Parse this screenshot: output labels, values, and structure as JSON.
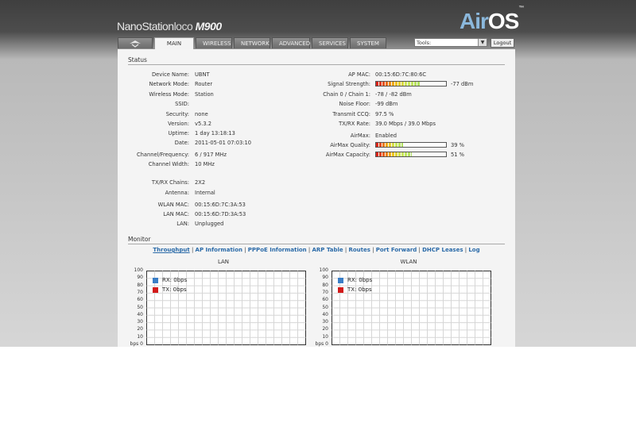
{
  "header": {
    "brand_name": "NanoStation",
    "brand_loco": "loco",
    "brand_model": "M900",
    "logo_air": "Air",
    "logo_os": "OS",
    "logo_tm": "™"
  },
  "tabs": [
    {
      "label": "",
      "icon": "ubiquiti-logo-icon"
    },
    {
      "label": "MAIN"
    },
    {
      "label": "WIRELESS"
    },
    {
      "label": "NETWORK"
    },
    {
      "label": "ADVANCED"
    },
    {
      "label": "SERVICES"
    },
    {
      "label": "SYSTEM"
    }
  ],
  "tools": {
    "selected": "Tools:",
    "arrow": "▼"
  },
  "logout_label": "Logout",
  "status": {
    "title": "Status",
    "left": [
      {
        "label": "Device Name:",
        "value": "UBNT"
      },
      {
        "label": "Network Mode:",
        "value": "Router"
      },
      {
        "label": "Wireless Mode:",
        "value": "Station"
      },
      {
        "label": "SSID:",
        "value": ""
      },
      {
        "label": "Security:",
        "value": "none"
      },
      {
        "label": "Version:",
        "value": "v5.3.2"
      },
      {
        "label": "Uptime:",
        "value": "1 day 13:18:13"
      },
      {
        "label": "Date:",
        "value": "2011-05-01 07:03:10"
      },
      {
        "label": "Channel/Frequency:",
        "value": "6 / 917 MHz"
      },
      {
        "label": "Channel Width:",
        "value": "10 MHz"
      },
      {
        "label": "TX/RX Chains:",
        "value": "2X2"
      },
      {
        "label": "Antenna:",
        "value": "Internal"
      },
      {
        "label": "WLAN MAC:",
        "value": "00:15:6D:7C:3A:53"
      },
      {
        "label": "LAN MAC:",
        "value": "00:15:6D:7D:3A:53"
      },
      {
        "label": "LAN:",
        "value": "Unplugged"
      }
    ],
    "right": [
      {
        "label": "AP MAC:",
        "value": "00:15:6D:7C:80:6C"
      },
      {
        "label": "Signal Strength:",
        "value": "-77 dBm",
        "meter": 0.62
      },
      {
        "label": "Chain 0 / Chain 1:",
        "value": "-78 / -82 dBm"
      },
      {
        "label": "Noise Floor:",
        "value": "-99 dBm"
      },
      {
        "label": "Transmit CCQ:",
        "value": "97.5 %"
      },
      {
        "label": "TX/RX Rate:",
        "value": "39.0 Mbps / 39.0 Mbps"
      },
      {
        "label": "AirMax:",
        "value": "Enabled"
      },
      {
        "label": "AirMax Quality:",
        "value": "39 %",
        "meter": 0.39
      },
      {
        "label": "AirMax Capacity:",
        "value": "51 %",
        "meter": 0.51
      }
    ]
  },
  "monitor": {
    "title": "Monitor",
    "links": [
      "Throughput",
      "AP Information",
      "PPPoE Information",
      "ARP Table",
      "Routes",
      "Port Forward",
      "DHCP Leases",
      "Log"
    ],
    "separator": "|"
  },
  "chart_data": [
    {
      "type": "line",
      "title": "LAN",
      "y_ticks": [
        "100",
        "90",
        "80",
        "70",
        "60",
        "50",
        "40",
        "30",
        "20",
        "10",
        "bps 0"
      ],
      "ylim": [
        0,
        100
      ],
      "series": [
        {
          "name": "RX: 0bps",
          "color": "#3a7ec6",
          "values": []
        },
        {
          "name": "TX: 0bps",
          "color": "#d21a1a",
          "values": []
        }
      ],
      "grid": true
    },
    {
      "type": "line",
      "title": "WLAN",
      "y_ticks": [
        "100",
        "90",
        "80",
        "70",
        "60",
        "50",
        "40",
        "30",
        "20",
        "10",
        "bps 0"
      ],
      "ylim": [
        0,
        100
      ],
      "series": [
        {
          "name": "RX: 0bps",
          "color": "#3a7ec6",
          "values": []
        },
        {
          "name": "TX: 0bps",
          "color": "#d21a1a",
          "values": []
        }
      ],
      "grid": true
    }
  ]
}
